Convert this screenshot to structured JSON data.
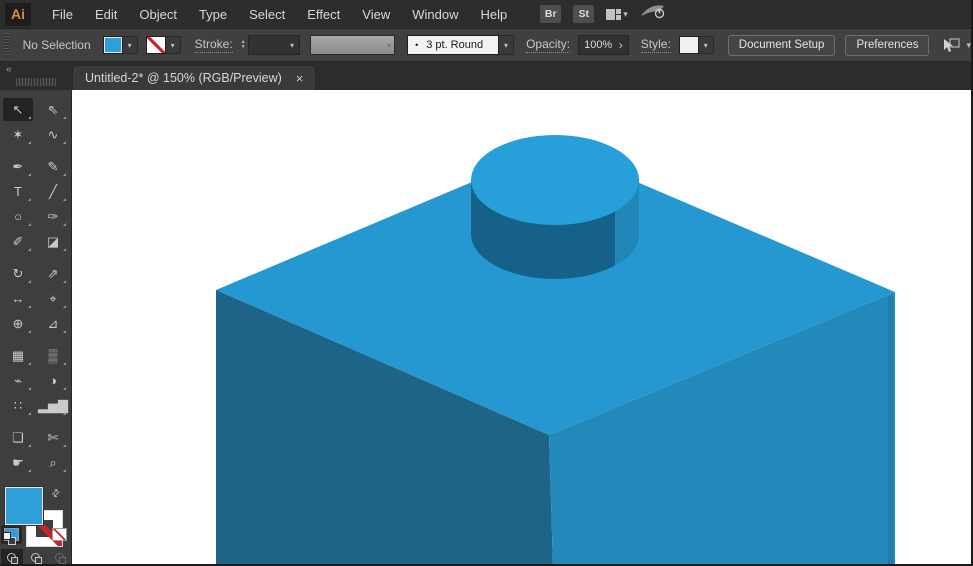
{
  "menu": {
    "logo": "Ai",
    "items": [
      "File",
      "Edit",
      "Object",
      "Type",
      "Select",
      "Effect",
      "View",
      "Window",
      "Help"
    ],
    "bridge_badge": "Br",
    "stock_badge": "St"
  },
  "control_bar": {
    "selection_status": "No Selection",
    "fill_color": "#2e9fd8",
    "stroke_label": "Stroke:",
    "brush_bullet": "•",
    "brush_value": "3 pt. Round",
    "opacity_label": "Opacity:",
    "opacity_value": "100%",
    "style_label": "Style:",
    "document_setup_label": "Document Setup",
    "preferences_label": "Preferences"
  },
  "tab": {
    "title": "Untitled-2* @ 150% (RGB/Preview)"
  },
  "glyphs": {
    "collapse": "«",
    "close": "×",
    "chevron_down": "▾",
    "spinner_up": "▲",
    "spinner_down": "▼",
    "opacity_next": "›",
    "swap": "⇄"
  },
  "toolbar": {
    "tools": [
      {
        "name": "selection",
        "glyph": "↖",
        "active": true
      },
      {
        "name": "direct-selection",
        "glyph": "⇖"
      },
      {
        "name": "magic-wand",
        "glyph": "✶"
      },
      {
        "name": "lasso",
        "glyph": "∿"
      },
      {
        "name": "pen",
        "glyph": "✒"
      },
      {
        "name": "curvature",
        "glyph": "✎"
      },
      {
        "name": "type",
        "glyph": "T"
      },
      {
        "name": "line-segment",
        "glyph": "╱"
      },
      {
        "name": "ellipse",
        "glyph": "○"
      },
      {
        "name": "paintbrush",
        "glyph": "✑"
      },
      {
        "name": "shaper",
        "glyph": "✐"
      },
      {
        "name": "eraser",
        "glyph": "◪"
      },
      {
        "name": "rotate",
        "glyph": "↻"
      },
      {
        "name": "scale",
        "glyph": "⇗"
      },
      {
        "name": "width",
        "glyph": "↔"
      },
      {
        "name": "puppet-warp",
        "glyph": "⌖"
      },
      {
        "name": "shape-builder",
        "glyph": "⊕"
      },
      {
        "name": "perspective-grid",
        "glyph": "⊿"
      },
      {
        "name": "mesh",
        "glyph": "▦"
      },
      {
        "name": "gradient",
        "glyph": "▒"
      },
      {
        "name": "eyedropper",
        "glyph": "⌁"
      },
      {
        "name": "blend",
        "glyph": "◑"
      },
      {
        "name": "symbol-sprayer",
        "glyph": "∷"
      },
      {
        "name": "column-graph",
        "glyph": "▂▅▇"
      },
      {
        "name": "artboard",
        "glyph": "❏"
      },
      {
        "name": "slice",
        "glyph": "✄"
      },
      {
        "name": "hand",
        "glyph": "☛"
      },
      {
        "name": "zoom",
        "glyph": "⌕"
      }
    ]
  },
  "fill_stroke": {
    "fill_color": "#2e9fd8"
  },
  "artwork": {
    "description": "3D blue LEGO-style brick with one stud, drawn on white artboard",
    "colors": {
      "top_face": "#2598d2",
      "left_face": "#1d6486",
      "right_face": "#2289ba",
      "right_edge": "#1e7dab",
      "stud_top": "#279fd8",
      "stud_side_dark": "#16618a",
      "stud_side_light": "#2187b7"
    }
  }
}
